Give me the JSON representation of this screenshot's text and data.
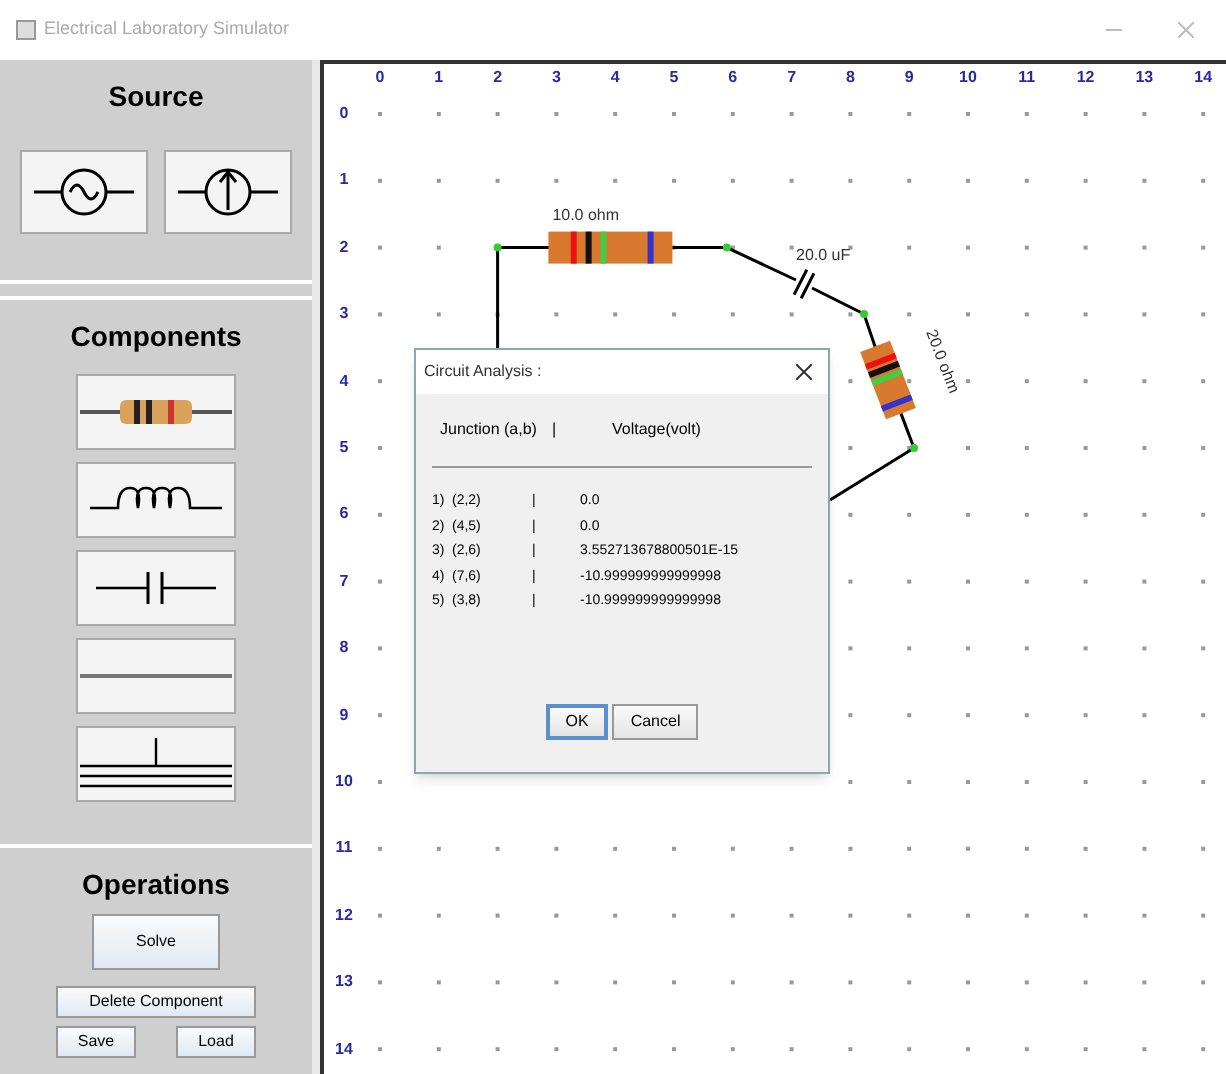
{
  "window": {
    "title": "Electrical Laboratory Simulator"
  },
  "source": {
    "title": "Source",
    "items": [
      {
        "kind": "voltage"
      },
      {
        "kind": "current"
      }
    ]
  },
  "components": {
    "title": "Components",
    "items": [
      {
        "kind": "resistor"
      },
      {
        "kind": "inductor"
      },
      {
        "kind": "capacitor"
      },
      {
        "kind": "wire"
      },
      {
        "kind": "ground"
      }
    ]
  },
  "operations": {
    "title": "Operations",
    "buttons": [
      "Solve",
      "Delete Component",
      "Save",
      "Load"
    ]
  },
  "grid": {
    "columns": [
      "0",
      "1",
      "2",
      "3",
      "4",
      "5",
      "6",
      "7",
      "8",
      "9",
      "10",
      "11",
      "12",
      "13",
      "14"
    ],
    "rows": [
      "0",
      "1",
      "2",
      "3",
      "4",
      "5",
      "6",
      "7",
      "8",
      "9",
      "10",
      "11",
      "12",
      "13",
      "14"
    ]
  },
  "circuit": {
    "elements": [
      {
        "kind": "resistor",
        "label": "10.0 ohm"
      },
      {
        "kind": "capacitor",
        "label": "20.0 uF"
      },
      {
        "kind": "resistor",
        "label": "20.0 ohm"
      }
    ]
  },
  "dialog": {
    "title": "Circuit Analysis :",
    "header": [
      "Junction (a,b)",
      "|",
      "Voltage(volt)"
    ],
    "rows": [
      {
        "index": "1)",
        "junction": "(2,2)",
        "sep": "|",
        "voltage": "0.0"
      },
      {
        "index": "2)",
        "junction": "(4,5)",
        "sep": "|",
        "voltage": "0.0"
      },
      {
        "index": "3)",
        "junction": "(2,6)",
        "sep": "|",
        "voltage": "3.552713678800501E-15"
      },
      {
        "index": "4)",
        "junction": "(7,6)",
        "sep": "|",
        "voltage": "-10.999999999999998"
      },
      {
        "index": "5)",
        "junction": "(3,8)",
        "sep": "|",
        "voltage": "-10.999999999999998"
      }
    ],
    "buttons": [
      {
        "label": "OK",
        "selected": true
      },
      {
        "label": "Cancel",
        "selected": false
      }
    ]
  }
}
